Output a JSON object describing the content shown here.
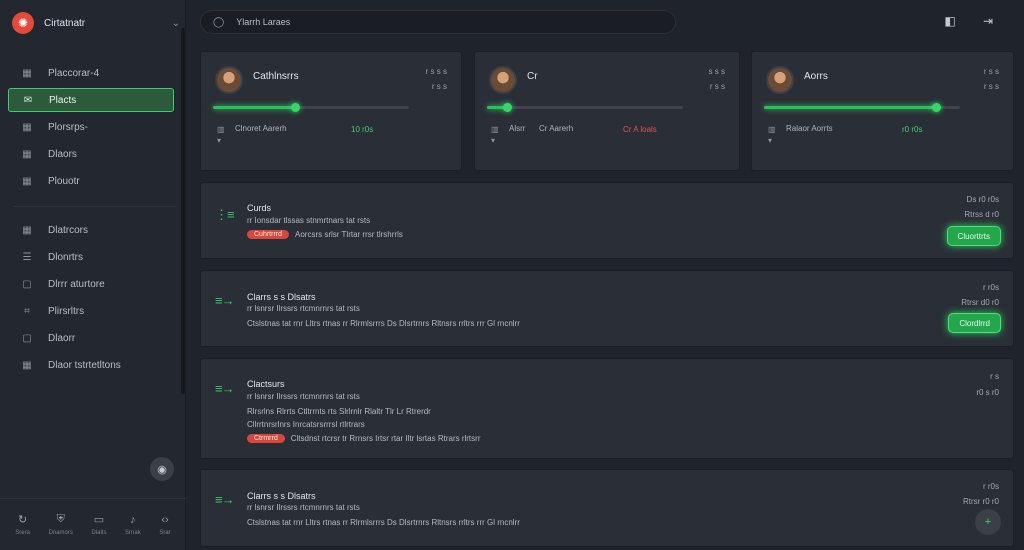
{
  "brand": {
    "name": "Cirtatnatr"
  },
  "sidebar": {
    "items": [
      {
        "label": "Placcorar-4",
        "icon": "grid-icon"
      },
      {
        "label": "Placts",
        "icon": "chat-icon",
        "active": true
      },
      {
        "label": "Plorsrps-",
        "icon": "grid-icon"
      },
      {
        "label": "Dlaors",
        "icon": "grid-icon"
      },
      {
        "label": "Plouotr",
        "icon": "grid-icon"
      }
    ],
    "items2": [
      {
        "label": "Dlatrcors",
        "icon": "grid-icon"
      },
      {
        "label": "Dlonrtrs",
        "icon": "list-icon"
      },
      {
        "label": "Dlrrr aturtore",
        "icon": "panel-icon"
      },
      {
        "label": "Plirsrltrs",
        "icon": "code-icon"
      },
      {
        "label": "Dlaorr",
        "icon": "panel-icon"
      },
      {
        "label": "Dlaor tstrtetltons",
        "icon": "grid-icon"
      }
    ],
    "bottom": [
      {
        "label": "Srera",
        "icon": "refresh-icon"
      },
      {
        "label": "Dnamors",
        "icon": "shield-icon"
      },
      {
        "label": "Dlalts",
        "icon": "folder-icon"
      },
      {
        "label": "Srnak",
        "icon": "bell-icon"
      },
      {
        "label": "Srar",
        "icon": "code-icon"
      }
    ]
  },
  "search": {
    "placeholder": "Ylarrh Laraes"
  },
  "cards": [
    {
      "name": "Cathlnsrrs",
      "meta_a": "r  s  s  s",
      "meta_b": "r s s",
      "progress": 0.42,
      "foot_label": "Clnoret Aarerh",
      "foot_value": "10  r0s",
      "value_color": "g"
    },
    {
      "name": "Cr",
      "meta_a": "s  s  s",
      "meta_b": "r s s",
      "progress": 0.1,
      "foot_label": "Alsrr",
      "foot_label2": "Cr Aarerh",
      "foot_value": "Cr A loals",
      "value_color": "r"
    },
    {
      "name": "Aorrs",
      "meta_a": "r  s  s",
      "meta_b": "r s s",
      "progress": 0.88,
      "foot_label": "Ralaor Aorrts",
      "foot_value": "r0  r0s",
      "value_color": "g"
    }
  ],
  "rows": [
    {
      "title": "Curds",
      "line1": "rr  Ionsdar tlssas stnmrtnars tat rsts",
      "tag": "Cuhrtrrrd",
      "line2": "Aorcsrs srlsr  Tlrtar  rrsr tlrshrrls",
      "rt1": "Ds  r0  r0s",
      "rt2": "Rtrss  d r0",
      "button": "Cluorttrts"
    },
    {
      "title": "Clarrs s  s Dlsatrs",
      "line1": "rr  lsnrsr  Ilrssrs rtcmnrnrs tat rsts",
      "line2": "Ctslstnas tat  rnr  Lltrs rtnas  rr  Rlrmlsrrrs  Ds  Dlsrtrnrs  Rltnsrs  rrltrs  rrr  Gl rncnlrr",
      "rt1": "r  r0s",
      "rt2": "Rtrsr  d0 r0",
      "button": "Clordlrrd"
    },
    {
      "title": "Clactsurs",
      "line1": "rr  lsnrsr  Ilrssrs rtcmnrnrs tat rsts",
      "line2a": "Rlrsrlns  Rlrrts  Ctltrrnts rts  Slrlrnlr  Rlaltr  Tlr  Lr  Rtrerdr",
      "line2b": "Cllrrtnrsrlnrs Inrcatsrsrrrsl rtlrtrars",
      "tag": "Ctrmrrd",
      "line3": "Cltsdnst rtcrsr tr  Rrnsrs  Irtsr  rtar  Iltr lsrtas  Rtrars  rlrtsrr",
      "rt1": "r  s",
      "rt2": "r0  s r0"
    },
    {
      "title": "Clarrs s  s Dlsatrs",
      "line1": "rr  lsnrsr  Ilrssrs rtcmnrnrs tat rsts",
      "line2": "Ctslstnas tat  rnr  Lltrs rtnas  rr  Rlrmlsrrrs  Ds  Dlsrtrnrs  Rltnsrs  rrltrs  rrr  Gl rncnlrr",
      "rt1": "r  r0s",
      "rt2": "Rtrsr  r0 r0"
    }
  ],
  "colors": {
    "accent": "#36c763",
    "danger": "#d8473b",
    "bg": "#1f232b",
    "card": "#2a2e37"
  }
}
